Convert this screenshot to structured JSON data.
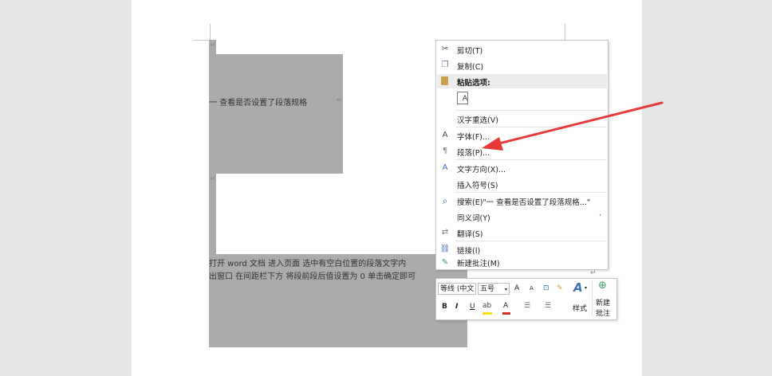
{
  "document": {
    "heading": "一  查看是否设置了段落规格",
    "body_line1": "打开 word 文档   进入页面   选中有空白位置的段落文字内",
    "body_line2": "出窗口   在间距栏下方   将段前段后值设置为 0   单击确定即可",
    "pilcrow": "↵"
  },
  "context_menu": {
    "items": [
      {
        "icon": "scissors-icon",
        "glyph": "✂",
        "label": "剪切(T)"
      },
      {
        "icon": "copy-icon",
        "glyph": "❐",
        "label": "复制(C)"
      },
      {
        "icon": "clipboard-icon",
        "glyph": "📋",
        "label": "粘贴选项:"
      },
      {
        "icon": "paste-text-only-icon",
        "glyph": "A",
        "label": ""
      },
      {
        "icon": "none",
        "glyph": "",
        "label": "汉字重选(V)"
      },
      {
        "icon": "font-icon",
        "glyph": "A",
        "label": "字体(F)..."
      },
      {
        "icon": "paragraph-icon",
        "glyph": "¶",
        "label": "段落(P)..."
      },
      {
        "icon": "text-direction-icon",
        "glyph": "A",
        "label": "文字方向(X)..."
      },
      {
        "icon": "none",
        "glyph": "",
        "label": "插入符号(S)"
      },
      {
        "icon": "search-icon",
        "glyph": "⌕",
        "label": "搜索(E)\"一  查看是否设置了段落规格...\""
      },
      {
        "icon": "none",
        "glyph": "",
        "label": "同义词(Y)"
      },
      {
        "icon": "translate-icon",
        "glyph": "⇄",
        "label": "翻译(S)"
      },
      {
        "icon": "link-icon",
        "glyph": "⛓",
        "label": "链接(I)"
      },
      {
        "icon": "new-comment-icon",
        "glyph": "✎",
        "label": "新建批注(M)"
      }
    ],
    "submenu_arrow": "›"
  },
  "mini_toolbar": {
    "font_name": "等线 (中文",
    "font_size": "五号",
    "grow_font": "A",
    "shrink_font": "A",
    "bold": "B",
    "italic": "I",
    "underline": "U",
    "styles_label": "样式",
    "new_comment_label_1": "新建",
    "new_comment_label_2": "批注"
  },
  "colors": {
    "selection": "#ababab",
    "annotation_arrow": "#e8393a",
    "highlight_yellow": "#f4e11b",
    "font_color_red": "#d32f2f"
  }
}
